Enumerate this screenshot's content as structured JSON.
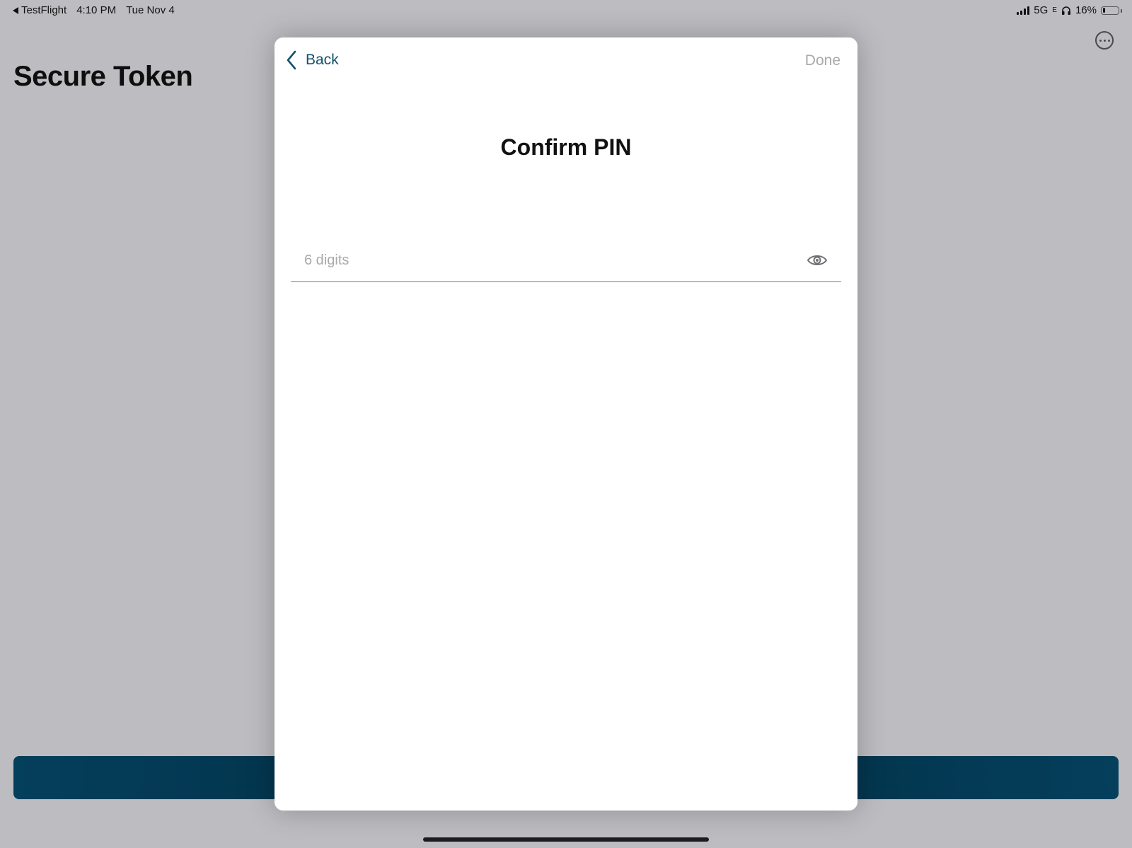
{
  "status_bar": {
    "back_app": "TestFlight",
    "time": "4:10 PM",
    "date": "Tue Nov 4",
    "network": "5G",
    "network_sub": "E",
    "battery": "16%",
    "battery_level": 0.16,
    "icons": [
      "cellular-signal-icon",
      "headphones-icon",
      "battery-icon"
    ]
  },
  "background": {
    "page_title": "Secure Token",
    "button_color": "#043f5c"
  },
  "modal": {
    "back_label": "Back",
    "done_label": "Done",
    "title": "Confirm PIN",
    "pin_input": {
      "value": "",
      "placeholder": "6 digits"
    },
    "accent_color": "#14506e",
    "icons": [
      "chevron-left-icon",
      "eye-icon"
    ]
  }
}
